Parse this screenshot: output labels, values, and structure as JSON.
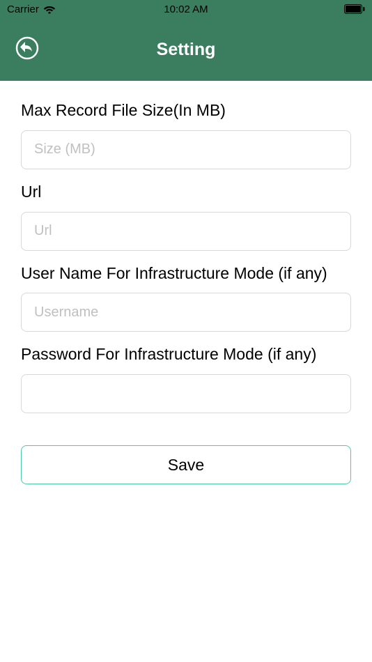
{
  "statusbar": {
    "carrier": "Carrier",
    "time": "10:02 AM"
  },
  "header": {
    "title": "Setting"
  },
  "form": {
    "max_size": {
      "label": "Max Record File Size(In MB)",
      "placeholder": "Size (MB)",
      "value": ""
    },
    "url": {
      "label": "Url",
      "placeholder": "Url",
      "value": ""
    },
    "username": {
      "label": "User Name For Infrastructure Mode (if any)",
      "placeholder": "Username",
      "value": ""
    },
    "password": {
      "label": "Password For Infrastructure Mode (if any)",
      "placeholder": "",
      "value": ""
    },
    "save_label": "Save"
  }
}
